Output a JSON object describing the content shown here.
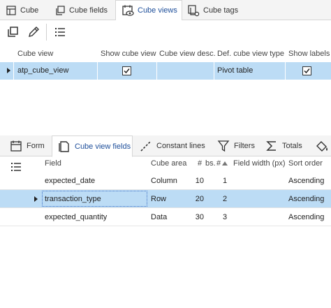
{
  "top_tabs": [
    {
      "label": "Cube",
      "icon": "cube-grid-icon",
      "active": false
    },
    {
      "label": "Cube fields",
      "icon": "copy-icon",
      "active": false
    },
    {
      "label": "Cube views",
      "icon": "calendar-eye-icon",
      "active": true
    },
    {
      "label": "Cube tags",
      "icon": "tag-pages-icon",
      "active": false
    }
  ],
  "toolbar": {
    "copy_icon": "copy-icon",
    "edit_icon": "pencil-icon",
    "columns_icon": "list-columns-icon"
  },
  "cube_views_grid": {
    "columns": [
      "Cube view",
      "Show cube view",
      "Cube view desc.",
      "Def. cube view type",
      "Show labels"
    ],
    "rows": [
      {
        "cube_view": "atp_cube_view",
        "show_cube_view": true,
        "cube_view_desc": "",
        "def_cube_view_type": "Pivot table",
        "show_labels": true,
        "selected": true
      }
    ]
  },
  "bottom_tabs": [
    {
      "label": "Form",
      "icon": "calendar-form-icon",
      "active": false
    },
    {
      "label": "Cube view fields",
      "icon": "folder-icon",
      "active": true
    },
    {
      "label": "Constant lines",
      "icon": "dashed-line-icon",
      "active": false
    },
    {
      "label": "Filters",
      "icon": "funnel-icon",
      "active": false
    },
    {
      "label": "Totals",
      "icon": "sigma-icon",
      "active": false
    },
    {
      "label": "",
      "icon": "paint-bucket-icon",
      "active": false
    }
  ],
  "fields_grid": {
    "columns": [
      "Field",
      "Cube area",
      "#",
      "bs.",
      "#",
      "Field width (px)",
      "Sort order"
    ],
    "rows": [
      {
        "field": "expected_date",
        "cube_area": "Column",
        "bs": "10",
        "num": "1",
        "width": "",
        "sort": "Ascending",
        "selected": false
      },
      {
        "field": "transaction_type",
        "cube_area": "Row",
        "bs": "20",
        "num": "2",
        "width": "",
        "sort": "Ascending",
        "selected": true
      },
      {
        "field": "expected_quantity",
        "cube_area": "Data",
        "bs": "30",
        "num": "3",
        "width": "",
        "sort": "Ascending",
        "selected": false
      }
    ]
  },
  "colors": {
    "selection": "#bcdcf5",
    "active_tab_text": "#1d4e9a",
    "tab_bar_bg": "#f4f4f4"
  }
}
